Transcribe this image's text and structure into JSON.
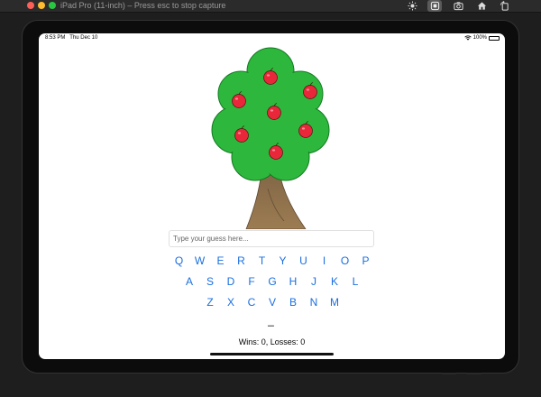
{
  "window": {
    "title": "iPad Pro (11-inch) – Press esc to stop capture"
  },
  "status_bar": {
    "time": "8:53 PM",
    "date": "Thu Dec 10",
    "battery": "100%"
  },
  "game": {
    "input_placeholder": "Type your guess here...",
    "keyboard_rows": [
      [
        "Q",
        "W",
        "E",
        "R",
        "T",
        "Y",
        "U",
        "I",
        "O",
        "P"
      ],
      [
        "A",
        "S",
        "D",
        "F",
        "G",
        "H",
        "J",
        "K",
        "L"
      ],
      [
        "Z",
        "X",
        "C",
        "V",
        "B",
        "N",
        "M"
      ]
    ],
    "word_display": "_",
    "score": "Wins: 0, Losses: 0",
    "apples_remaining": 7
  },
  "colors": {
    "key_text": "#1a6fe0",
    "tree_foliage": "#2db83d",
    "trunk": "#8b6d47",
    "apple": "#e8283a"
  },
  "icons": [
    "brightness-icon",
    "home-button-icon",
    "screenshot-icon",
    "home-icon",
    "rotate-icon",
    "wifi-icon",
    "battery-icon"
  ]
}
